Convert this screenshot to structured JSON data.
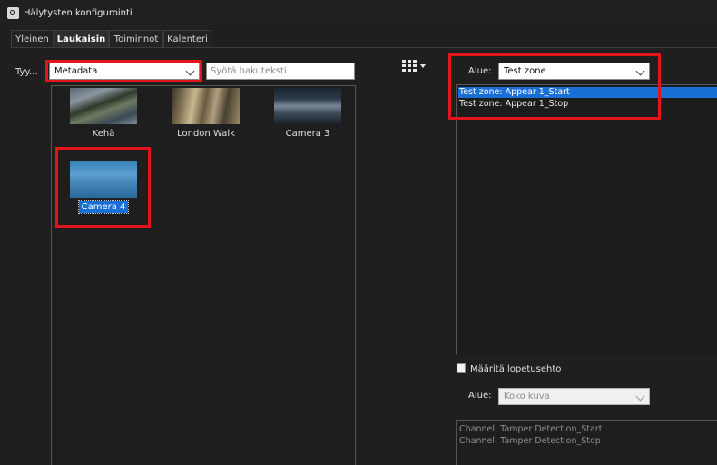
{
  "window": {
    "title": "Hälytysten konfigurointi"
  },
  "tabs": [
    {
      "label": "Yleinen",
      "active": false
    },
    {
      "label": "Laukaisin",
      "active": true
    },
    {
      "label": "Toiminnot",
      "active": false
    },
    {
      "label": "Kalenteri",
      "active": false
    }
  ],
  "left": {
    "type_label": "Tyy...",
    "type_value": "Metadata",
    "search_placeholder": "Syötä hakuteksti",
    "view_icon": "grid-view-icon",
    "cameras": [
      {
        "name": "Kehä",
        "selected": false
      },
      {
        "name": "London Walk",
        "selected": false
      },
      {
        "name": "Camera 3",
        "selected": false
      },
      {
        "name": "Camera 4",
        "selected": true
      }
    ]
  },
  "right": {
    "area_label": "Alue:",
    "area_value": "Test zone",
    "zone_items": [
      {
        "label": "Test zone: Appear 1_Start",
        "selected": true
      },
      {
        "label": "Test zone: Appear 1_Stop",
        "selected": false
      }
    ],
    "stop_condition_label": "Määritä lopetusehto",
    "stop_condition_checked": false,
    "stop_area_label": "Alue:",
    "stop_area_value": "Koko kuva",
    "channel_items": [
      "Channel: Tamper Detection_Start",
      "Channel: Tamper Detection_Stop"
    ]
  },
  "colors": {
    "highlight": "#e0161b",
    "selection": "#1a6fd6",
    "background": "#1f1f1f"
  }
}
